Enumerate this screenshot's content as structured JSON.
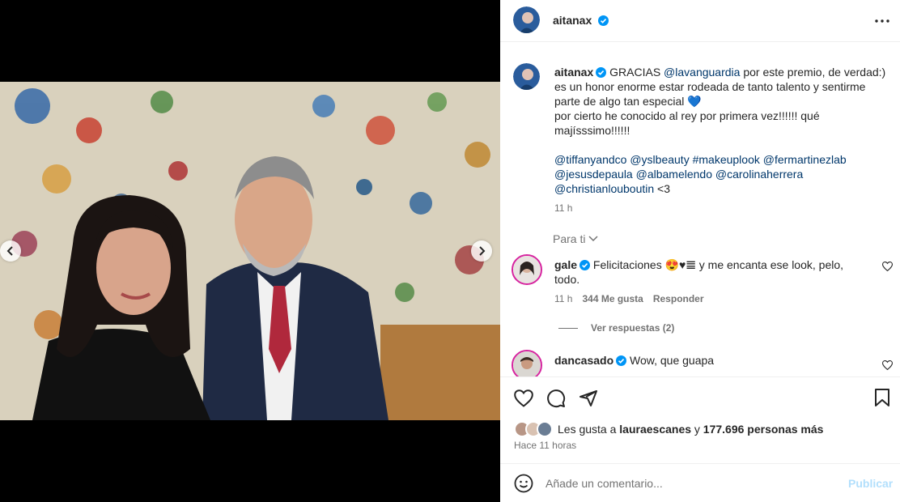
{
  "post": {
    "author": "aitanax",
    "more_icon": "more-horizontal-icon",
    "caption": {
      "username": "aitanax",
      "text_1": "GRACIAS ",
      "mention_1": "@lavanguardia",
      "text_2": " por este premio, de verdad:)",
      "line_2": "es un honor enorme estar rodeada de tanto talento y sentirme",
      "line_3": "parte de algo tan especial 💙",
      "line_4": "por cierto he conocido al rey por primera vez!!!!!! qué",
      "line_5": "majísssimo!!!!!!",
      "tags_line_1": "@tiffanyandco @yslbeauty #makeuplook @fermartinezlab",
      "tags_line_2": "@jesusdepaula @albamelendo @carolinaherrera",
      "tags_line_3": "@christianlouboutin",
      "tags_suffix": " <3",
      "time": "11 h"
    },
    "for_you_label": "Para ti",
    "comments": [
      {
        "username": "gale",
        "text_a": "Felicitaciones 😍♥︎𝌆 y me encanta ese look, pelo,",
        "text_b": "todo.",
        "time": "11 h",
        "likes": "344 Me gusta",
        "reply": "Responder",
        "view_replies": "Ver respuestas (2)"
      },
      {
        "username": "dancasado",
        "text": "Wow, que guapa"
      }
    ],
    "likes": {
      "prefix": "Les gusta a ",
      "user": "lauraescanes",
      "middle": " y ",
      "count": "177.696 personas más"
    },
    "posted_ago": "Hace 11 horas",
    "comment_placeholder": "Añade un comentario...",
    "publish_label": "Publicar"
  },
  "carousel": {
    "total": 10,
    "active_index": 5
  },
  "colors": {
    "verified": "#0095f6",
    "link": "#00376b",
    "publish_disabled": "#b2dffc"
  }
}
